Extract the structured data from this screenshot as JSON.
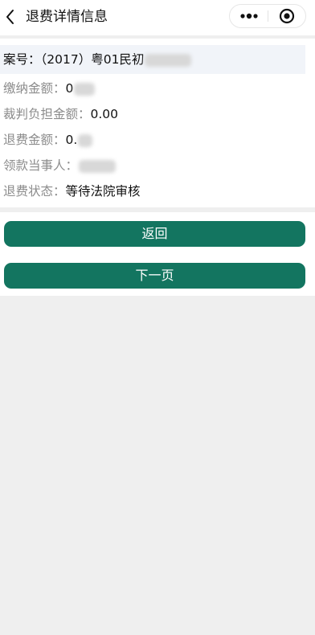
{
  "header": {
    "title": "退费详情信息",
    "back_icon": "chevron-left-icon",
    "more_icon": "more-dots-icon",
    "close_icon": "record-circle-icon"
  },
  "details": {
    "case_label": "案号：",
    "case_value": "（2017）粤01民初",
    "paid_label": "缴纳金额：",
    "paid_value": "0",
    "burden_label": "裁判负担金额：",
    "burden_value": "0.00",
    "refund_label": "退费金额：",
    "refund_value": "0.",
    "payee_label": "领款当事人：",
    "payee_value": "",
    "status_label": "退费状态：",
    "status_value": "等待法院审核"
  },
  "buttons": {
    "back_label": "返回",
    "next_label": "下一页"
  },
  "colors": {
    "button_bg": "#137560",
    "case_row_bg": "#f1f4f9",
    "page_bg": "#efefef"
  }
}
